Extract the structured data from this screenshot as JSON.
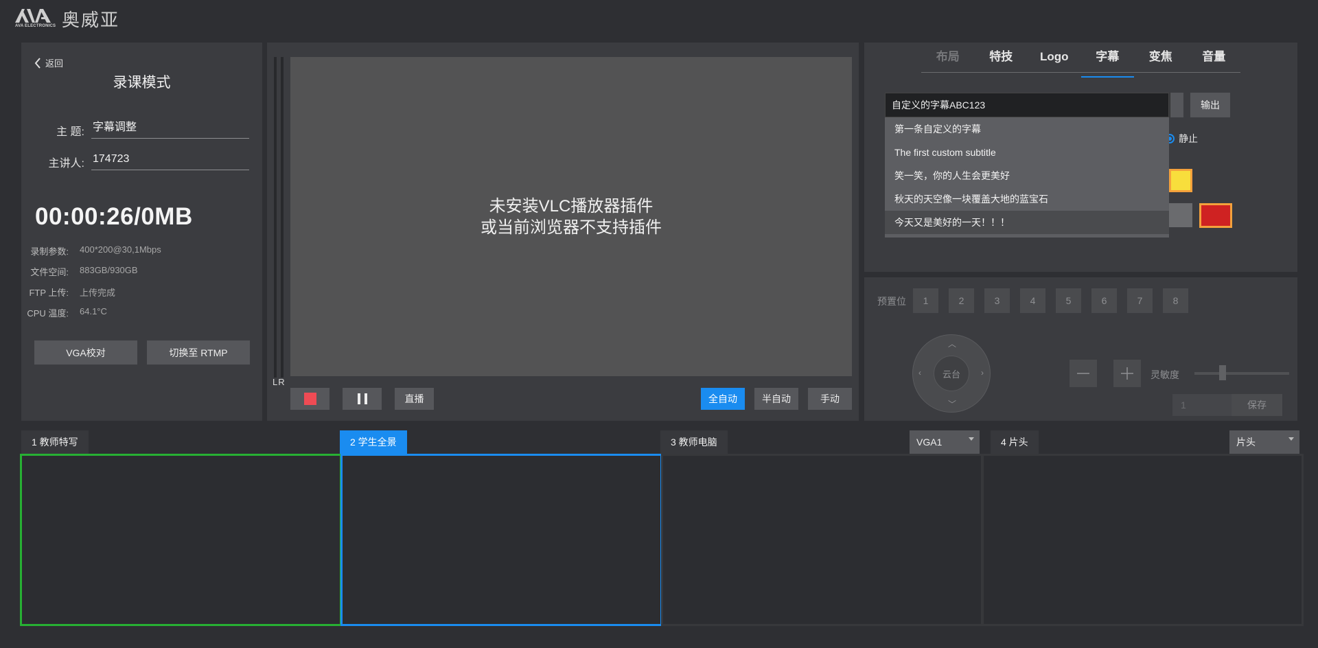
{
  "brand": {
    "sub": "AVA ELECTRONICS",
    "name": "奥威亚"
  },
  "left": {
    "back_label": "返回",
    "mode_title": "录课模式",
    "topic_label": "主 题:",
    "topic_value": "字幕调整",
    "speaker_label": "主讲人:",
    "speaker_value": "174723",
    "timer": "00:00:26/0MB",
    "stats": [
      {
        "key": "录制参数:",
        "value": "400*200@30,1Mbps"
      },
      {
        "key": "文件空间:",
        "value": "883GB/930GB"
      },
      {
        "key": "FTP 上传:",
        "value": "上传完成"
      },
      {
        "key": "CPU 温度:",
        "value": "64.1°C"
      }
    ],
    "vga_button": "VGA校对",
    "rtmp_button": "切换至 RTMP"
  },
  "center": {
    "vu_label": "LR",
    "message_line1": "未安装VLC播放器插件",
    "message_line2": "或当前浏览器不支持插件",
    "live_button": "直播",
    "mode_buttons": {
      "full_auto": "全自动",
      "semi_auto": "半自动",
      "manual": "手动"
    }
  },
  "right": {
    "tabs": [
      "布局",
      "特技",
      "Logo",
      "字幕",
      "变焦",
      "音量"
    ],
    "active_tab": "字幕",
    "subtitle_value": "自定义的字幕ABC123",
    "output_button": "输出",
    "subtitle_options": [
      "第一条自定义的字幕",
      "The first custom subtitle",
      "笑一笑，你的人生会更美好",
      "秋天的天空像一块覆盖大地的蓝宝石",
      "今天又是美好的一天！！！"
    ],
    "radio_static": "静止",
    "colors": {
      "swatch_yellow": "#f8de3c",
      "swatch_red": "#cf2222",
      "swatch_border": "#f4a13c"
    },
    "preset_label": "预置位",
    "presets": [
      "1",
      "2",
      "3",
      "4",
      "5",
      "6",
      "7",
      "8"
    ],
    "ptz_label": "云台",
    "sensitivity_label": "灵敏度",
    "sensitivity_value": "1",
    "save_button": "保存"
  },
  "sources": [
    {
      "label": "1 教师特写"
    },
    {
      "label": "2 学生全景"
    },
    {
      "label": "3 教师电脑",
      "select": "VGA1"
    },
    {
      "label": "4 片头",
      "select": "片头"
    }
  ],
  "accent_colors": {
    "blue": "#1a8cf0",
    "green": "#27b033",
    "record_red": "#ef4b54"
  }
}
